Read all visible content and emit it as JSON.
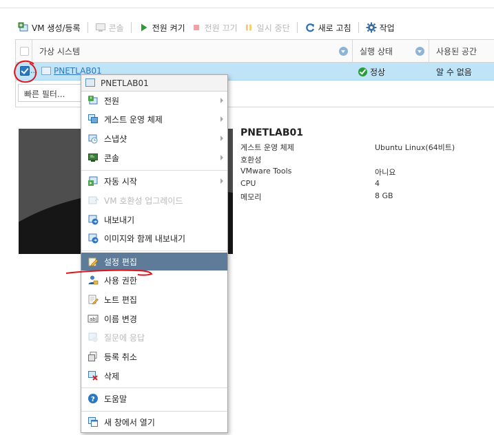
{
  "toolbar": {
    "vm_create": "VM 생성/등록",
    "console": "콘솔",
    "power_on": "전원 켜기",
    "power_off": "전원 끄기",
    "suspend": "일시 중단",
    "refresh": "새로 고침",
    "actions": "작업"
  },
  "grid": {
    "headers": {
      "name": "가상 시스템",
      "state": "실행 상태",
      "space": "사용된 공간"
    },
    "row": {
      "dots": "...",
      "name": "PNETLAB01",
      "state": "정상",
      "space": "알 수 없음"
    },
    "filter_placeholder": "빠른 필터..."
  },
  "details": {
    "title": "PNETLAB01",
    "rows": [
      {
        "label": "게스트 운영 체제",
        "value": "Ubuntu Linux(64비트)"
      },
      {
        "label": "호환성",
        "value": ""
      },
      {
        "label": "VMware Tools",
        "value": "아니요"
      },
      {
        "label": "CPU",
        "value": "4"
      },
      {
        "label": "메모리",
        "value": "8 GB"
      }
    ]
  },
  "menu": {
    "title": "PNETLAB01",
    "items": [
      {
        "label": "전원",
        "icon": "power-icon"
      },
      {
        "label": "게스트 운영 체제",
        "icon": "guest-os-icon"
      },
      {
        "label": "스냅샷",
        "icon": "snapshot-icon"
      },
      {
        "label": "콘솔",
        "icon": "console-icon"
      },
      {
        "label": "자동 시작",
        "icon": "autostart-icon"
      },
      {
        "label": "VM 호환성 업그레이드",
        "icon": "upgrade-icon"
      },
      {
        "label": "내보내기",
        "icon": "export-icon"
      },
      {
        "label": "이미지와 함께 내보내기",
        "icon": "export-image-icon"
      },
      {
        "label": "설정 편집",
        "icon": "edit-settings-icon"
      },
      {
        "label": "사용 권한",
        "icon": "permissions-icon"
      },
      {
        "label": "노트 편집",
        "icon": "edit-notes-icon"
      },
      {
        "label": "이름 변경",
        "icon": "rename-icon"
      },
      {
        "label": "질문에 응답",
        "icon": "answer-question-icon"
      },
      {
        "label": "등록 취소",
        "icon": "unregister-icon"
      },
      {
        "label": "삭제",
        "icon": "delete-icon"
      },
      {
        "label": "도움말",
        "icon": "help-icon"
      },
      {
        "label": "새 창에서 열기",
        "icon": "new-window-icon"
      }
    ]
  },
  "colors": {
    "row_selected": "#bfe3f7",
    "menu_active": "#5e7b99",
    "annotation_red": "#e0141b",
    "link": "#2f77bd"
  }
}
